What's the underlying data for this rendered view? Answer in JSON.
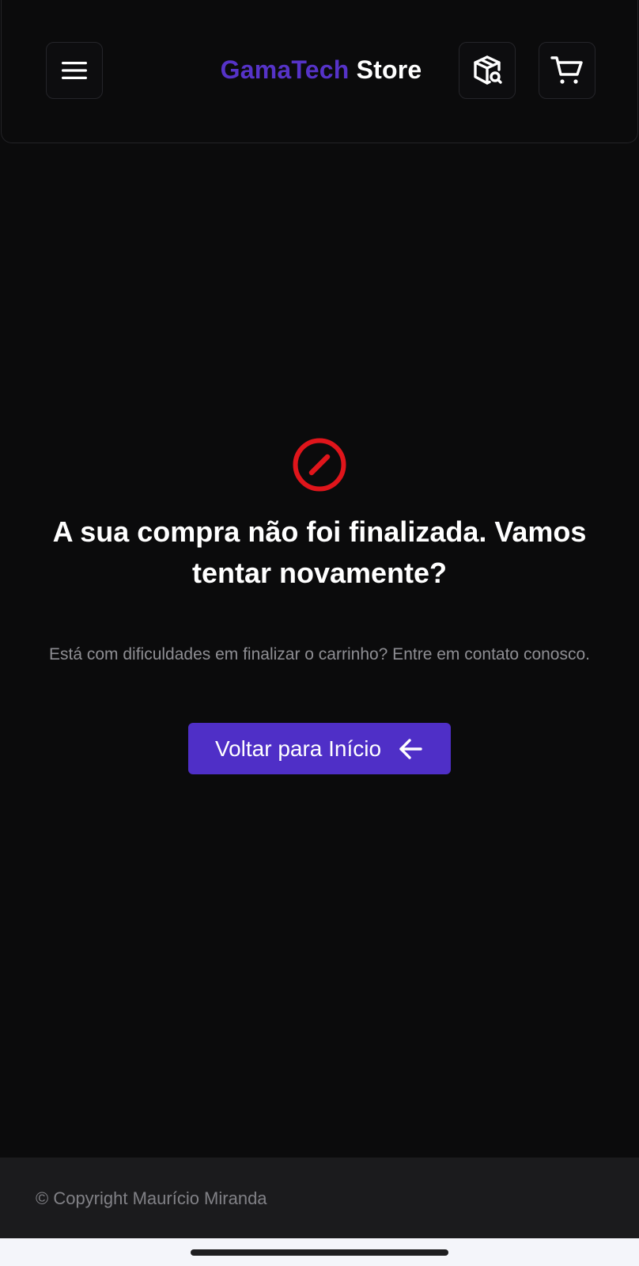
{
  "header": {
    "brand_accent": "GamaTech",
    "brand_rest": " Store",
    "menu_icon": "hamburger-menu-icon",
    "track_icon": "package-search-icon",
    "cart_icon": "shopping-cart-icon"
  },
  "main": {
    "status_icon": "ban-circle-icon",
    "title": "A sua compra não foi finalizada. Vamos tentar novamente?",
    "subtitle": "Está com dificuldades em finalizar o carrinho? Entre em contato conosco.",
    "back_button_label": "Voltar para Início",
    "back_button_icon": "arrow-left-icon"
  },
  "footer": {
    "copyright": "© Copyright Maurício Miranda"
  },
  "colors": {
    "background": "#0b0b0c",
    "accent": "#4f2fc7",
    "brand_accent": "#5633c8",
    "error": "#e0151b",
    "footer": "#1b1b1d"
  }
}
